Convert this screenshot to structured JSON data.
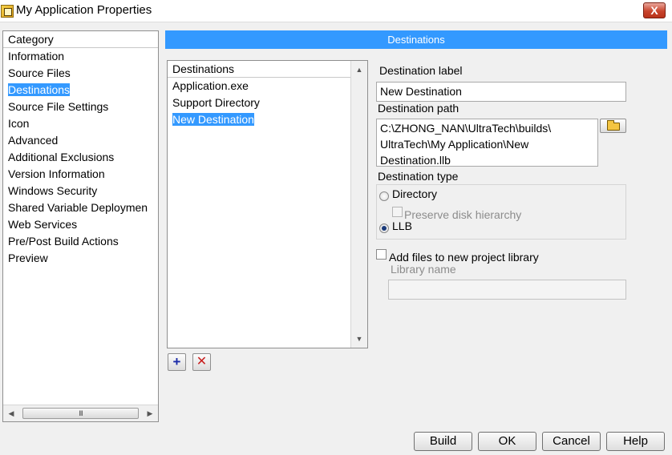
{
  "window": {
    "title": "My Application Properties",
    "close_label": "X"
  },
  "category": {
    "header": "Category",
    "items": [
      {
        "label": "Information"
      },
      {
        "label": "Source Files"
      },
      {
        "label": "Destinations",
        "selected": true
      },
      {
        "label": "Source File Settings"
      },
      {
        "label": "Icon"
      },
      {
        "label": "Advanced"
      },
      {
        "label": "Additional Exclusions"
      },
      {
        "label": "Version Information"
      },
      {
        "label": "Windows Security"
      },
      {
        "label": "Shared Variable Deploymen"
      },
      {
        "label": "Web Services"
      },
      {
        "label": "Pre/Post Build Actions"
      },
      {
        "label": "Preview"
      }
    ],
    "scroll_thumb_grip": "III"
  },
  "section": {
    "title": "Destinations"
  },
  "destinations": {
    "header": "Destinations",
    "items": [
      {
        "label": "Application.exe"
      },
      {
        "label": "Support Directory"
      },
      {
        "label": "New Destination",
        "selected": true
      }
    ],
    "add_label": "+",
    "remove_label": "✕"
  },
  "form": {
    "dest_label_title": "Destination label",
    "dest_label_value": "New Destination",
    "dest_path_title": "Destination path",
    "dest_path_value": "C:\\ZHONG_NAN\\UltraTech\\builds\\\nUltraTech\\My Application\\New\nDestination.llb",
    "dest_type_title": "Destination type",
    "type_directory": "Directory",
    "preserve_hierarchy": "Preserve disk hierarchy",
    "type_llb": "LLB",
    "selected_type": "LLB",
    "add_to_library": "Add files to new project library",
    "add_to_library_checked": false,
    "library_name_label": "Library name",
    "library_name_value": ""
  },
  "footer": {
    "build": "Build",
    "ok": "OK",
    "cancel": "Cancel",
    "help": "Help"
  },
  "colors": {
    "accent": "#3399ff",
    "background": "#f0f0f0"
  }
}
